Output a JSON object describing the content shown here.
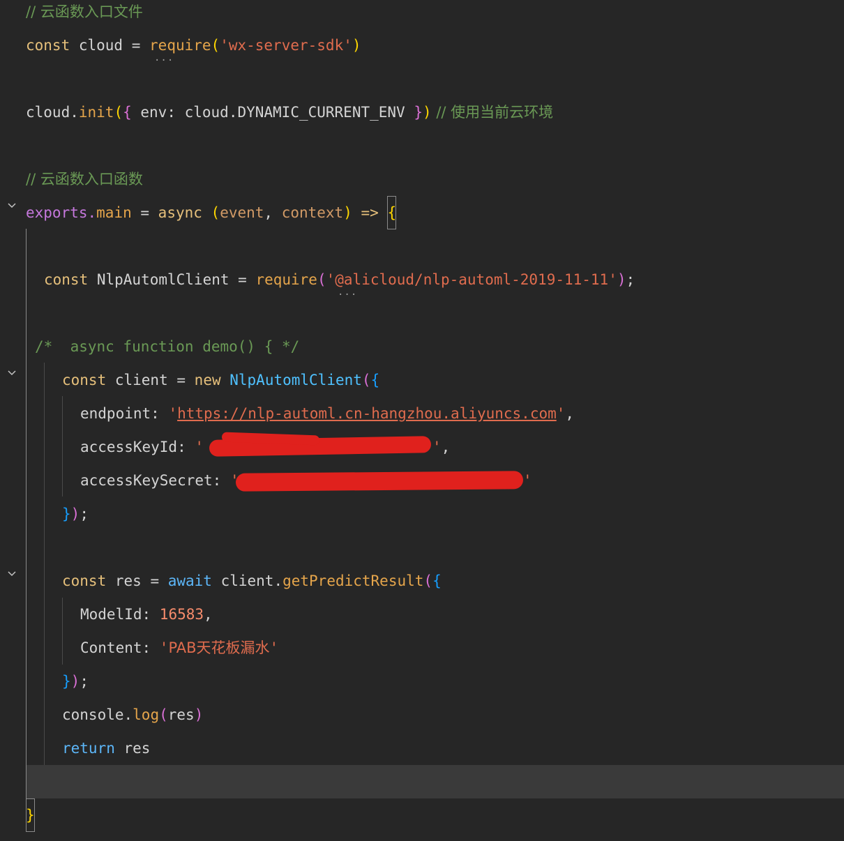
{
  "editor": {
    "lines": {
      "l1_comment": "// 云函数入口文件",
      "l2_const": "const",
      "l2_var": " cloud ",
      "l2_eq": "= ",
      "l2_require": "require",
      "l2_paren_open": "(",
      "l2_str": "'wx-server-sdk'",
      "l2_paren_close": ")",
      "l4_obj": "cloud.",
      "l4_method": "init",
      "l4_paren": "(",
      "l4_brace_open": "{",
      "l4_body": " env: cloud.DYNAMIC_CURRENT_ENV ",
      "l4_brace_close": "}",
      "l4_paren_close": ")",
      "l4_comment": " // 使用当前云环境",
      "l6_comment": "// 云函数入口函数",
      "l7_exports": "exports.",
      "l7_main": "main",
      "l7_eq": " = ",
      "l7_async": "async",
      "l7_paren_open": " (",
      "l7_event": "event",
      "l7_comma": ", ",
      "l7_context": "context",
      "l7_paren_close": ")",
      "l7_arrow": " => ",
      "l7_brace": "{",
      "l9_const": "const",
      "l9_var": " NlpAutomlClient ",
      "l9_eq": "= ",
      "l9_require": "require",
      "l9_paren_open": "(",
      "l9_str": "'@alicloud/nlp-automl-2019-11-11'",
      "l9_paren_close": ")",
      "l9_semi": ";",
      "l11_comment": "/*  async function demo() { */",
      "l12_const": "const",
      "l12_var": " client ",
      "l12_eq": "= ",
      "l12_new": "new",
      "l12_class": " NlpAutomlClient",
      "l12_paren": "(",
      "l12_brace": "{",
      "l13_key": "endpoint: ",
      "l13_q1": "'",
      "l13_url": "https://nlp-automl.cn-hangzhou.aliyuncs.com",
      "l13_q2": "'",
      "l13_comma": ",",
      "l14_key": "accessKeyId: ",
      "l14_q1": "'",
      "l14_q2": "'",
      "l14_comma": ",",
      "l15_key": "accessKeySecret: ",
      "l15_q1": "'",
      "l15_q2": "'",
      "l16_brace": "}",
      "l16_paren": ")",
      "l16_semi": ";",
      "l18_const": "const",
      "l18_var": " res ",
      "l18_eq": "= ",
      "l18_await": "await",
      "l18_obj": " client.",
      "l18_method": "getPredictResult",
      "l18_paren": "(",
      "l18_brace": "{",
      "l19_key": "ModelId: ",
      "l19_num": "16583",
      "l19_comma": ",",
      "l20_key": "Content: ",
      "l20_q1": "'",
      "l20_str": "PAB天花板漏水",
      "l20_q2": "'",
      "l21_brace": "}",
      "l21_paren": ")",
      "l21_semi": ";",
      "l22_obj": "console.",
      "l22_method": "log",
      "l22_paren_open": "(",
      "l22_arg": "res",
      "l22_paren_close": ")",
      "l23_return": "return",
      "l23_var": " res",
      "l25_brace": "}"
    },
    "hover_dots": "···",
    "colors": {
      "background": "#262626",
      "current_line": "#3a3a3a",
      "redaction": "#e0211d"
    }
  }
}
